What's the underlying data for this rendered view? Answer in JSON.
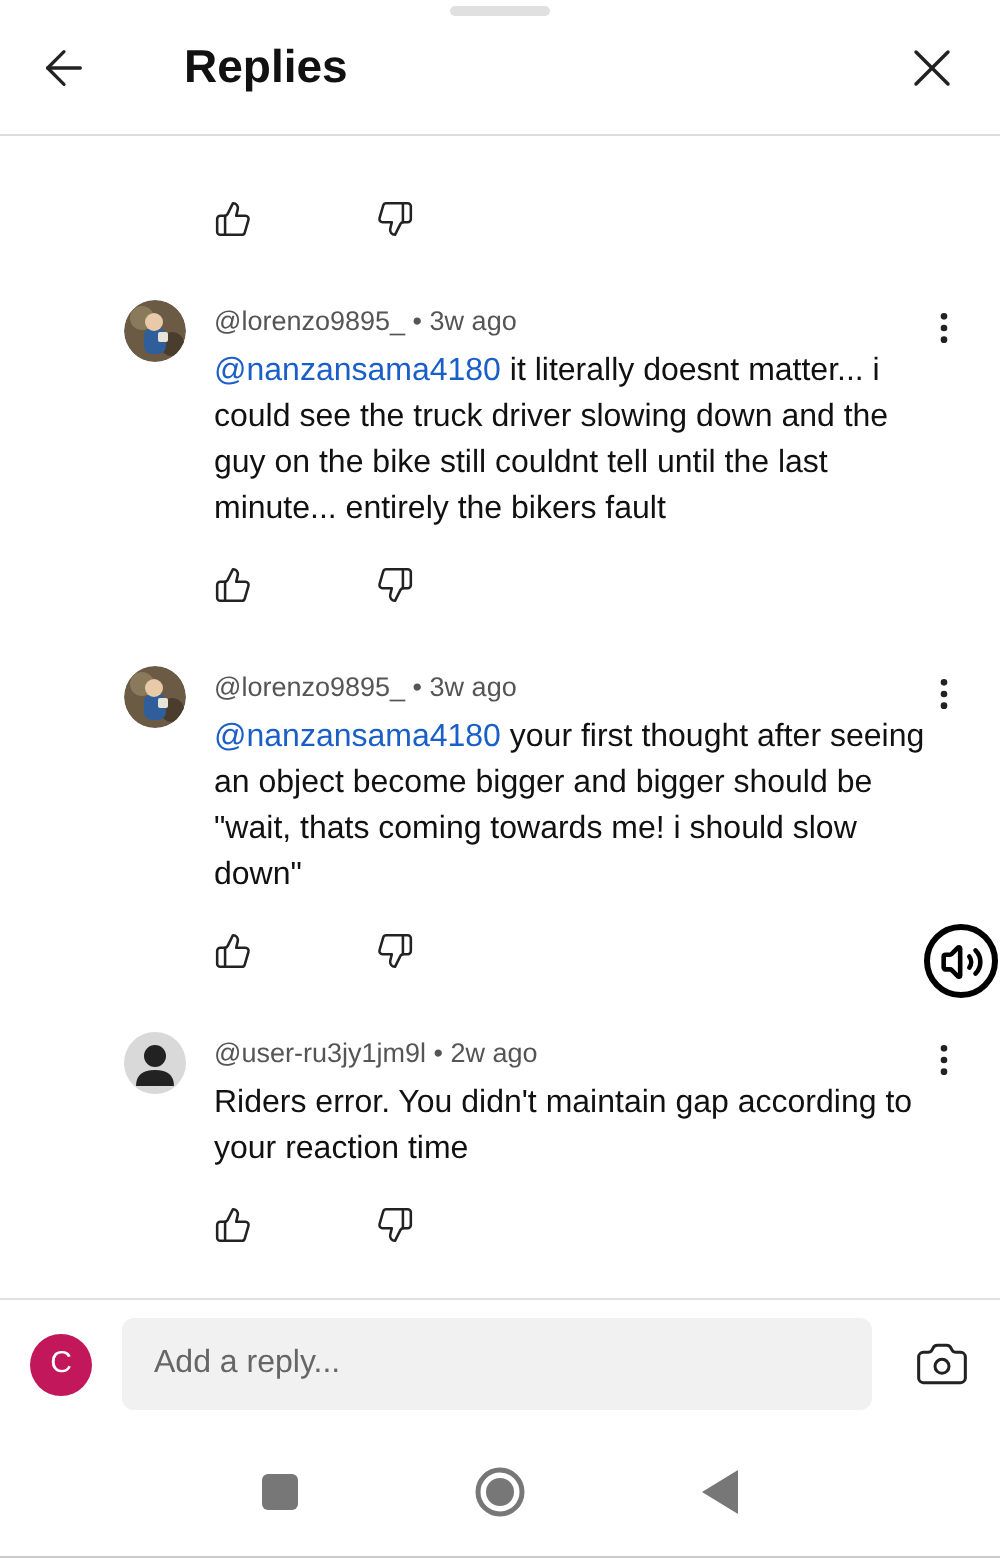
{
  "header": {
    "title": "Replies"
  },
  "comments": [
    {
      "author": "@lorenzo9895_",
      "separator": "•",
      "time": "3w ago",
      "mention": "@nanzansama4180",
      "text": " it literally doesnt matter... i could see the truck driver slowing down and the guy on the bike still couldnt tell until the last minute... entirely the bikers fault"
    },
    {
      "author": "@lorenzo9895_",
      "separator": "•",
      "time": "3w ago",
      "mention": "@nanzansama4180",
      "text": " your first thought after seeing an object become bigger and bigger should be \"wait, thats coming towards me! i should slow down\""
    },
    {
      "avatar": {
        "kind": "silhouette"
      },
      "author": "@user-ru3jy1jm9l",
      "separator": "•",
      "time": "2w ago",
      "text": "Riders error. You didn't maintain gap according to your reaction time"
    }
  ],
  "reply_bar": {
    "avatar_letter": "C",
    "placeholder": "Add a reply..."
  }
}
